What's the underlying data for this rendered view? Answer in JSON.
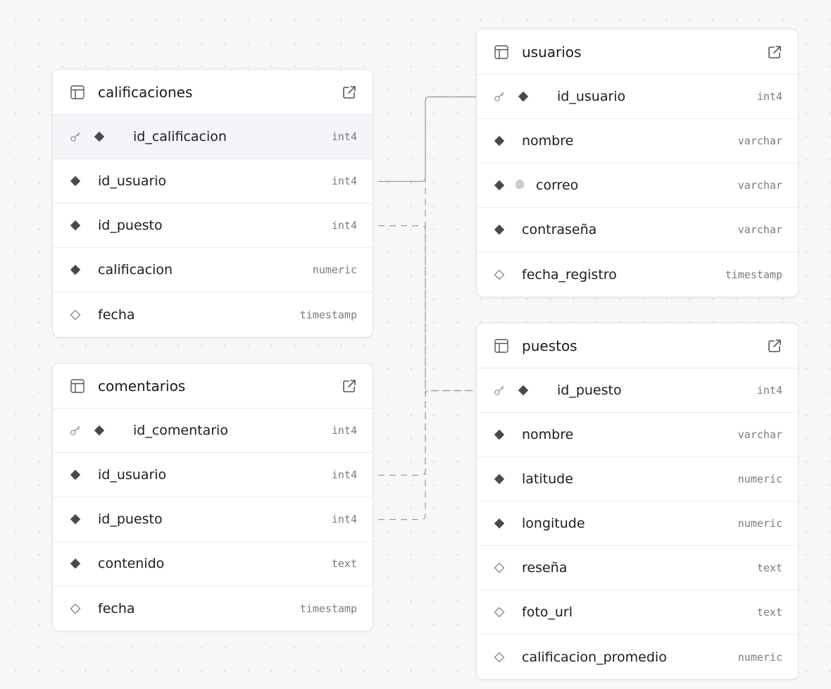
{
  "tables": {
    "calificaciones": {
      "name": "calificaciones",
      "columns": [
        {
          "name": "id_calificacion",
          "type": "int4",
          "marker": "filled",
          "key": true
        },
        {
          "name": "id_usuario",
          "type": "int4",
          "marker": "filled"
        },
        {
          "name": "id_puesto",
          "type": "int4",
          "marker": "filled"
        },
        {
          "name": "calificacion",
          "type": "numeric",
          "marker": "filled"
        },
        {
          "name": "fecha",
          "type": "timestamp",
          "marker": "hollow"
        }
      ]
    },
    "comentarios": {
      "name": "comentarios",
      "columns": [
        {
          "name": "id_comentario",
          "type": "int4",
          "marker": "filled",
          "key": true
        },
        {
          "name": "id_usuario",
          "type": "int4",
          "marker": "filled"
        },
        {
          "name": "id_puesto",
          "type": "int4",
          "marker": "filled"
        },
        {
          "name": "contenido",
          "type": "text",
          "marker": "filled"
        },
        {
          "name": "fecha",
          "type": "timestamp",
          "marker": "hollow"
        }
      ]
    },
    "usuarios": {
      "name": "usuarios",
      "columns": [
        {
          "name": "id_usuario",
          "type": "int4",
          "marker": "filled",
          "key": true
        },
        {
          "name": "nombre",
          "type": "varchar",
          "marker": "filled"
        },
        {
          "name": "correo",
          "type": "varchar",
          "marker": "filled",
          "unique": true
        },
        {
          "name": "contraseña",
          "type": "varchar",
          "marker": "filled"
        },
        {
          "name": "fecha_registro",
          "type": "timestamp",
          "marker": "hollow"
        }
      ]
    },
    "puestos": {
      "name": "puestos",
      "columns": [
        {
          "name": "id_puesto",
          "type": "int4",
          "marker": "filled",
          "key": true
        },
        {
          "name": "nombre",
          "type": "varchar",
          "marker": "filled"
        },
        {
          "name": "latitude",
          "type": "numeric",
          "marker": "filled"
        },
        {
          "name": "longitude",
          "type": "numeric",
          "marker": "filled"
        },
        {
          "name": "reseña",
          "type": "text",
          "marker": "hollow"
        },
        {
          "name": "foto_url",
          "type": "text",
          "marker": "hollow"
        },
        {
          "name": "calificacion_promedio",
          "type": "numeric",
          "marker": "hollow"
        }
      ]
    }
  },
  "relationships": [
    {
      "from": "calificaciones.id_usuario",
      "to": "usuarios.id_usuario"
    },
    {
      "from": "calificaciones.id_puesto",
      "to": "puestos.id_puesto"
    },
    {
      "from": "comentarios.id_usuario",
      "to": "usuarios.id_usuario"
    },
    {
      "from": "comentarios.id_puesto",
      "to": "puestos.id_puesto"
    }
  ],
  "colors": {
    "canvas": "#f7f7f7",
    "card": "#ffffff",
    "marker": "#4a4a4a",
    "type_text": "#7b7b7b",
    "connector": "#9a9a9a"
  },
  "icons": {
    "table": "table-icon",
    "open": "external-link-icon",
    "primary_key": "key-icon",
    "unique": "fingerprint-icon"
  }
}
